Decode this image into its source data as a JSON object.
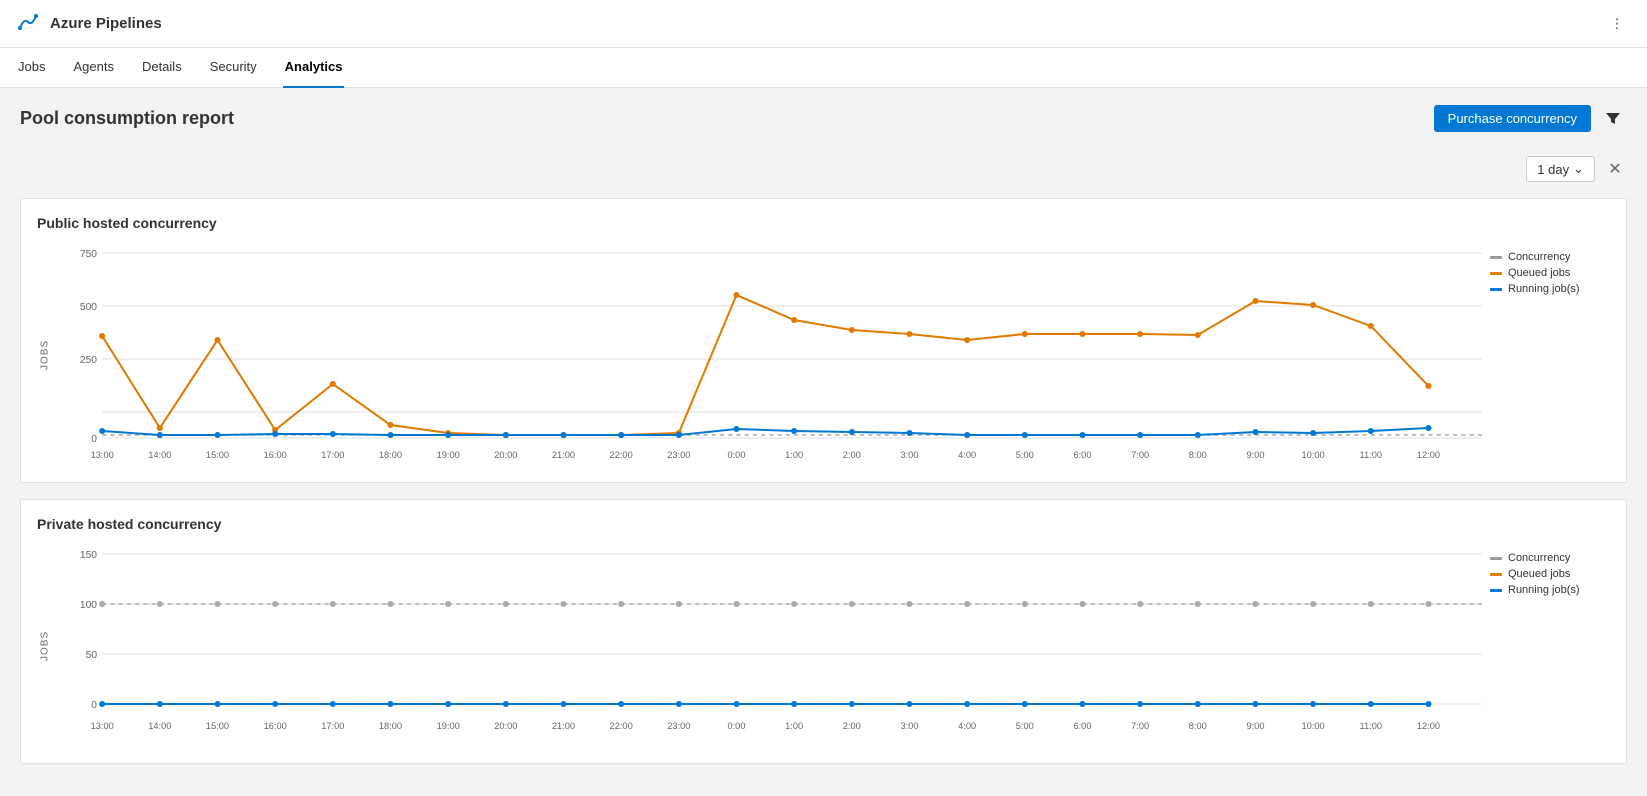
{
  "header": {
    "icon_label": "azure-pipelines-icon",
    "title": "Azure Pipelines",
    "more_label": "⋮"
  },
  "nav": {
    "items": [
      {
        "label": "Jobs",
        "active": false
      },
      {
        "label": "Agents",
        "active": false
      },
      {
        "label": "Details",
        "active": false
      },
      {
        "label": "Security",
        "active": false
      },
      {
        "label": "Analytics",
        "active": true
      }
    ]
  },
  "page": {
    "title": "Pool consumption report",
    "purchase_btn": "Purchase concurrency",
    "filter": {
      "day_option": "1 day"
    }
  },
  "legend": {
    "concurrency": "Concurrency",
    "queued": "Queued jobs",
    "running": "Running job(s)"
  },
  "public_chart": {
    "title": "Public hosted concurrency",
    "y_label": "JOBS",
    "y_ticks": [
      "750",
      "500",
      "250",
      "0"
    ],
    "x_labels": [
      "13:00",
      "14:00",
      "15:00",
      "16:00",
      "17:00",
      "18:00",
      "19:00",
      "20:00",
      "21:00",
      "22:00",
      "23:00",
      "0:00",
      "1:00",
      "2:00",
      "3:00",
      "4:00",
      "5:00",
      "6:00",
      "7:00",
      "8:00",
      "9:00",
      "10:00",
      "11:00",
      "12:00"
    ]
  },
  "private_chart": {
    "title": "Private hosted concurrency",
    "y_label": "JOBS",
    "y_ticks": [
      "150",
      "100",
      "50",
      "0"
    ],
    "x_labels": [
      "13:00",
      "14:00",
      "15:00",
      "16:00",
      "17:00",
      "18:00",
      "19:00",
      "20:00",
      "21:00",
      "22:00",
      "23:00",
      "0:00",
      "1:00",
      "2:00",
      "3:00",
      "4:00",
      "5:00",
      "6:00",
      "7:00",
      "8:00",
      "9:00",
      "10:00",
      "11:00",
      "12:00"
    ]
  }
}
